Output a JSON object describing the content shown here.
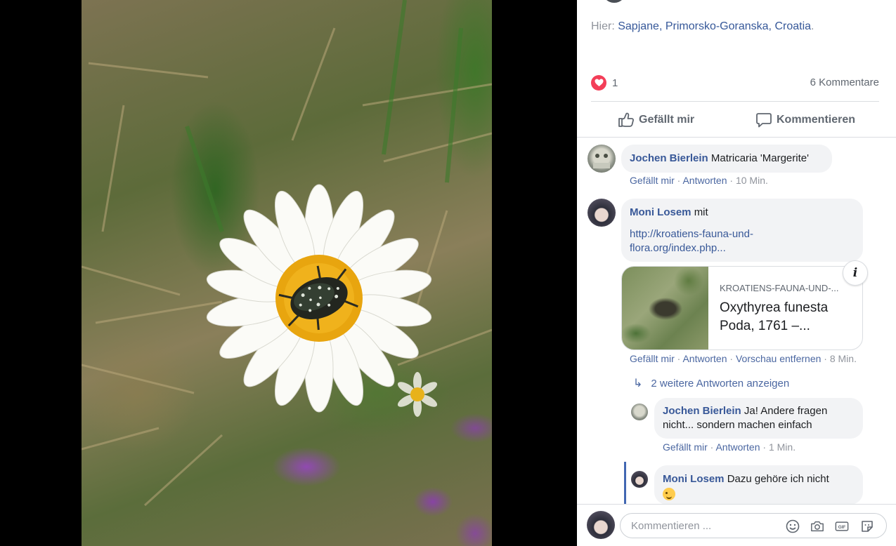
{
  "location": {
    "prefix": "Hier: ",
    "place": "Sapjane, Primorsko-Goranska, Croatia",
    "suffix": "."
  },
  "reactions": {
    "count": "1",
    "comments_label": "6 Kommentare"
  },
  "actions": {
    "like_label": "Gefällt mir",
    "comment_label": "Kommentieren"
  },
  "comments": [
    {
      "author": "Jochen Bierlein",
      "text": "Matricaria 'Margerite'",
      "meta": {
        "like": "Gefällt mir",
        "reply": "Antworten",
        "time": "10 Min."
      }
    },
    {
      "author": "Moni Losem",
      "text": "mit",
      "link": "http://kroatiens-fauna-und-flora.org/index.php...",
      "link_line1": "http://kroatiens-fauna-und-",
      "link_line2": "flora.org/index.php...",
      "preview": {
        "domain": "KROATIENS-FAUNA-UND-...",
        "title": "Oxythyrea funesta Poda, 1761 –..."
      },
      "meta": {
        "like": "Gefällt mir",
        "reply": "Antworten",
        "remove_preview": "Vorschau entfernen",
        "time": "8 Min."
      }
    }
  ],
  "more_replies": "2 weitere Antworten anzeigen",
  "replies": [
    {
      "author": "Jochen Bierlein",
      "text": "Ja! Andere fragen nicht... sondern machen einfach",
      "meta": {
        "like": "Gefällt mir",
        "reply": "Antworten",
        "time": "1 Min."
      }
    },
    {
      "author": "Moni Losem",
      "text": "Dazu gehöre ich nicht",
      "emoji": "winking-face"
    }
  ],
  "composer": {
    "placeholder": "Kommentieren ...",
    "icons": [
      "emoji-icon",
      "camera-icon",
      "gif-icon",
      "sticker-icon"
    ],
    "gif_label": "GIF"
  },
  "colors": {
    "link": "#385898",
    "heart": "#f33e58",
    "bubble": "#f2f3f5",
    "thread": "#4267b2"
  }
}
